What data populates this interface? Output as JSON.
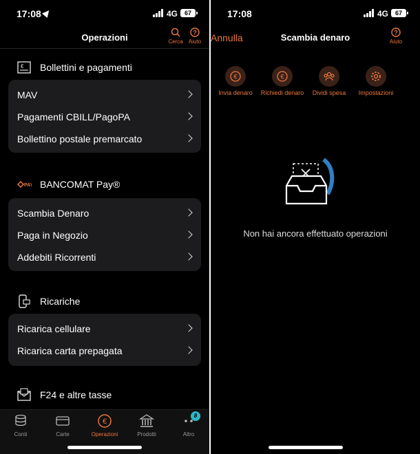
{
  "colors": {
    "accent": "#e9773f",
    "background": "#000000",
    "card": "#1c1c1e",
    "badge": "#2fb7c9"
  },
  "left": {
    "status": {
      "time": "17:08",
      "network": "4G",
      "battery": "67"
    },
    "header": {
      "title": "Operazioni",
      "search_label": "Cerca",
      "help_label": "Aiuto"
    },
    "sections": [
      {
        "title": "Bollettini e pagamenti",
        "icon": "bill-icon",
        "items": [
          "MAV",
          "Pagamenti CBILL/PagoPA",
          "Bollettino postale premarcato"
        ]
      },
      {
        "title": "BANCOMAT Pay®",
        "icon": "bancomat-pay-icon",
        "items": [
          "Scambia Denaro",
          "Paga in Negozio",
          "Addebiti Ricorrenti"
        ]
      },
      {
        "title": "Ricariche",
        "icon": "phone-recharge-icon",
        "items": [
          "Ricarica cellulare",
          "Ricarica carta prepagata"
        ]
      },
      {
        "title": "F24 e altre tasse",
        "icon": "envelope-icon",
        "items": []
      }
    ],
    "tabbar": [
      {
        "label": "Conti",
        "icon": "coins-icon",
        "active": false
      },
      {
        "label": "Carte",
        "icon": "card-icon",
        "active": false
      },
      {
        "label": "Operazioni",
        "icon": "euro-icon",
        "active": true
      },
      {
        "label": "Prodotti",
        "icon": "bank-icon",
        "active": false
      },
      {
        "label": "Altro",
        "icon": "more-icon",
        "active": false,
        "badge": "8"
      }
    ]
  },
  "right": {
    "status": {
      "time": "17:08",
      "network": "4G",
      "battery": "67"
    },
    "header": {
      "cancel_label": "Annulla",
      "title": "Scambia denaro",
      "help_label": "Aiuto"
    },
    "actions": [
      {
        "label": "Invia denaro",
        "icon": "send-money-icon"
      },
      {
        "label": "Richiedi denaro",
        "icon": "request-money-icon"
      },
      {
        "label": "Dividi spesa",
        "icon": "split-expense-icon"
      },
      {
        "label": "Impostazioni",
        "icon": "settings-icon"
      }
    ],
    "empty_state": {
      "icon": "empty-tray-icon",
      "message": "Non hai ancora effettuato operazioni"
    }
  }
}
